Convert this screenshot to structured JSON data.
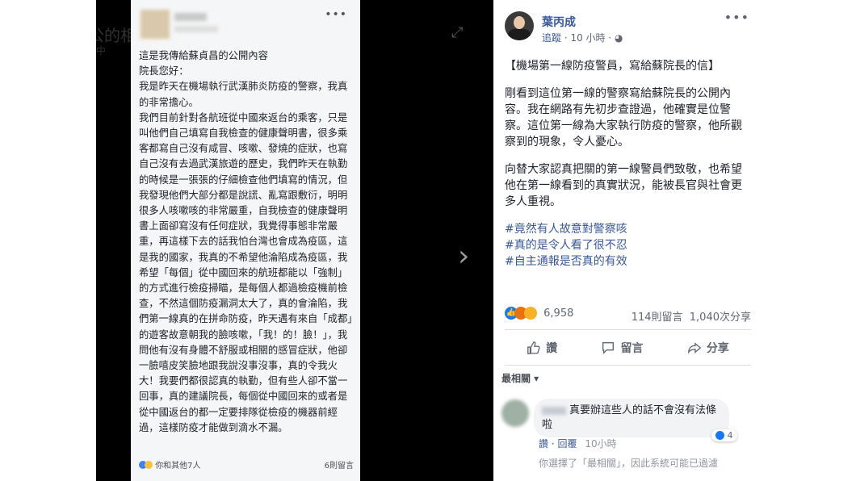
{
  "background": {
    "side_text": "公的相",
    "side_sub": "中"
  },
  "phone": {
    "lines": [
      "這是我傳給蘇貞昌的公開內容",
      "院長您好：",
      "我是昨天在機場執行武漢肺炎防疫的警察，我真的非常擔心。",
      "我們目前針對各航班從中國來返台的乘客，只是叫他們自己填寫自我檢查的健康聲明書，很多乘客都寫自己沒有咸冒、咳嗽、發燒的症狀，也寫自己沒有去過武漢旅遊的歷史，我們昨天在執勤的時候是一張張的仔細檢查他們填寫的情況，但我發現他們大部分都是說謊、亂寫跟敷衍，明明很多人咳嗽咳的非常嚴重，自我檢查的健康聲明書上面卻寫沒有任何症狀，我覺得事態非常嚴重，再這樣下去的話我怕台灣也會成為疫區，這是我的國家，我真的不希望他淪陷成為疫區，我希望「每個」從中國回來的航班都能以「強制」的方式進行檢疫掃瞄，是每個人都過檢疫機前檢查，不然這個防疫漏洞太大了，真的會淪陷，我們第一線真的在拼命防疫，昨天遇有來自「成都」的遊客故意朝我的臉咳嗽，「我！的！臉！」，我問他有沒有身體不舒服或相關的感冒症狀，他卻一臉嘻皮笑臉地跟我說沒事沒事，真的令我火大！我要們都很認真的執勤，但有些人卻不當一回事，真的建議院長，每個從中國回來的或者是從中國返台的都一定要排隊從檢疫的機器前經過，這樣防疫才能做到滴水不漏。"
    ],
    "reactions_text": "你和其他7人",
    "comments_text": "6則留言"
  },
  "post": {
    "author": "葉丙成",
    "follow": "追蹤",
    "time": "· 10 小時 · ◕",
    "paragraphs": [
      "【機場第一線防疫警員，寫給蘇院長的信】",
      "剛看到這位第一線的警察寫給蘇院長的公開內容。我在網路有先初步查證過，他確實是位警察。這位第一線為大家執行防疫的警察，他所觀察到的現象，令人憂心。",
      "向替大家認真把關的第一線警員們致敬，也希望他在第一線看到的真實狀況，能被長官與社會更多人重視。"
    ],
    "hashtags": [
      "#竟然有人故意對警察咳",
      "#真的是令人看了很不忍",
      "#自主通報是否真的有效"
    ]
  },
  "stats": {
    "reactions": "6,958",
    "comments": "114則留言",
    "shares": "1,040次分享"
  },
  "actions": {
    "like": "讚",
    "comment": "留言",
    "share": "分享"
  },
  "filter": {
    "label": "最相關 ▾"
  },
  "comment": {
    "text": "真要辦這些人的話不會沒有法條啦",
    "reaction_count": "4",
    "like": "讚",
    "reply": "回覆",
    "time": "10小時"
  },
  "notice": "你選擇了「最相關」，因此系統可能已過濾"
}
